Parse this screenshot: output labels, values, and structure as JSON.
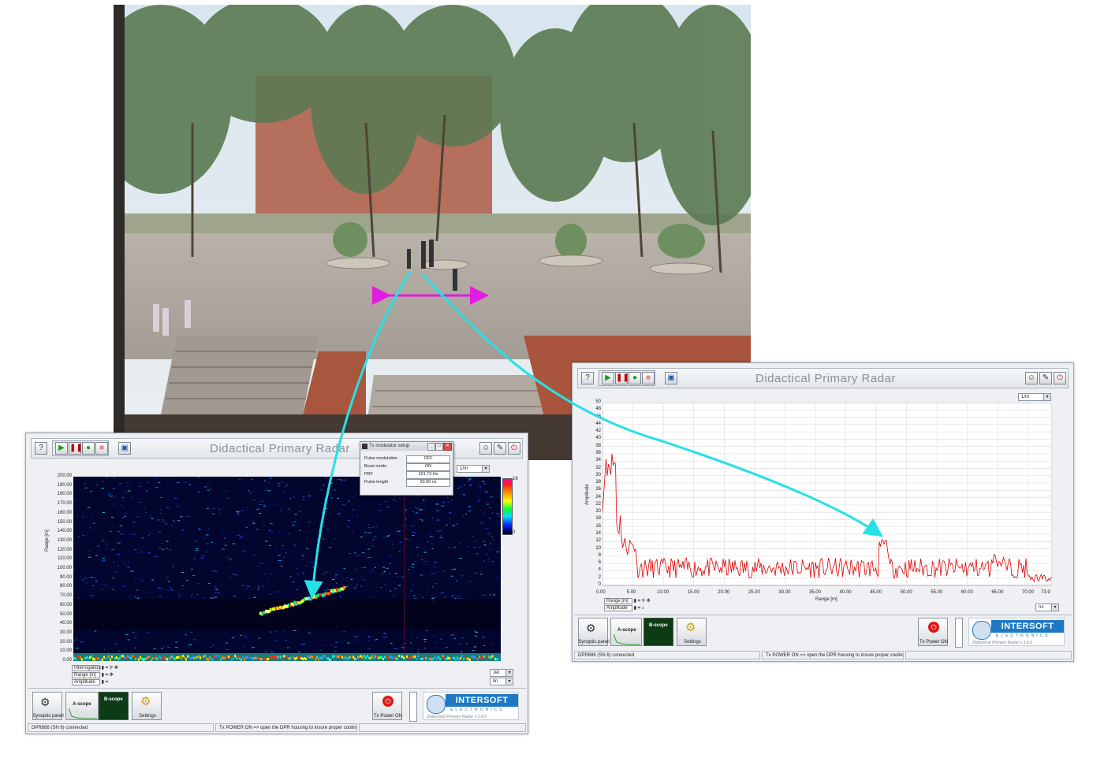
{
  "photo": {
    "description_icon": "campus-scene-photo"
  },
  "left_window": {
    "title": "Didactical Primary Radar",
    "range_selector": "1/m",
    "colorbar": {
      "max": "16",
      "min": "0"
    },
    "y_axis_label": "Range [m]",
    "y_ticks": [
      "200.00",
      "190.00",
      "180.00",
      "170.00",
      "160.00",
      "150.00",
      "140.00",
      "130.00",
      "120.00",
      "110.00",
      "100.00",
      "90.00",
      "80.00",
      "70.00",
      "60.00",
      "50.00",
      "40.00",
      "30.00",
      "20.00",
      "10.00",
      "0.00"
    ],
    "controls": [
      {
        "label": "Interrogation"
      },
      {
        "label": "Range [m]"
      },
      {
        "label": "Amplitude"
      }
    ],
    "select_jet": "Jet",
    "select_lin": "lin",
    "buttons": {
      "synoptic": "Synoptic panel",
      "ascope": "A-scope",
      "bscope": "B-scope",
      "settings": "Settings",
      "txpower": "Tx Power ON"
    },
    "status": {
      "left": "DPR886 (SN 6) connected",
      "middle": "Tx POWER ON => open the DPR housing to insure proper cooling",
      "right": ""
    }
  },
  "popup": {
    "title": "Tx modulator setup",
    "rows": [
      {
        "label": "Pulse modulation",
        "value": "OFF"
      },
      {
        "label": "Burst mode",
        "value": "ON"
      },
      {
        "label": "PRF",
        "value": "101.73 Hz"
      },
      {
        "label": "Pulse length",
        "value": "20.00 ns"
      }
    ]
  },
  "right_window": {
    "title": "Didactical Primary Radar",
    "range_selector": "1/m",
    "y_axis_label": "Amplitude",
    "x_axis_label": "Range [m]",
    "y_ticks": [
      "50",
      "48",
      "46",
      "44",
      "42",
      "40",
      "38",
      "36",
      "34",
      "32",
      "30",
      "28",
      "26",
      "24",
      "22",
      "20",
      "18",
      "16",
      "14",
      "12",
      "10",
      "8",
      "6",
      "4",
      "2",
      "0"
    ],
    "x_ticks": [
      "0.00",
      "5.00",
      "10.00",
      "15.00",
      "20.00",
      "25.00",
      "30.00",
      "35.00",
      "40.00",
      "45.00",
      "50.00",
      "55.00",
      "60.00",
      "65.00",
      "70.00",
      "73.9"
    ],
    "controls": [
      {
        "label": "Range [m]"
      },
      {
        "label": "Amplitude"
      }
    ],
    "select_ns": "ns",
    "buttons": {
      "synoptic": "Synoptic panel",
      "ascope": "A-scope",
      "bscope": "B-scope",
      "settings": "Settings",
      "txpower": "Tx Power ON"
    },
    "status": {
      "left": "DPR886 (SN 6) connected",
      "middle": "Tx POWER ON => open the DPR housing to insure proper cooling",
      "right": ""
    }
  },
  "logo": {
    "brand": "INTERSOFT",
    "sub": "ELECTRONICS",
    "version": "Didactical Primary Radar v 1.0.0"
  },
  "colors": {
    "arrow_cyan": "#27e0e6",
    "arrow_magenta": "#e21be0",
    "trace_red": "#e00000",
    "brand_blue": "#1e78c2"
  }
}
